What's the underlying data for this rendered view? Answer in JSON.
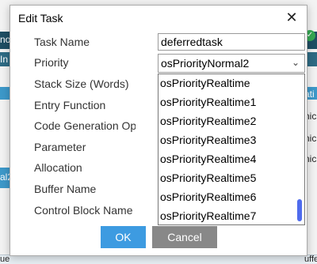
{
  "background": {
    "left_fragments": [
      "no",
      "In",
      "al2"
    ],
    "right_fragments": [
      "ati",
      "nic",
      "nic",
      "nic"
    ],
    "bottom_fragments": [
      "ueu",
      "uffe"
    ]
  },
  "dialog": {
    "title": "Edit Task",
    "fields": [
      {
        "label": "Task Name"
      },
      {
        "label": "Priority"
      },
      {
        "label": "Stack Size (Words)"
      },
      {
        "label": "Entry Function"
      },
      {
        "label": "Code Generation Option"
      },
      {
        "label": "Parameter"
      },
      {
        "label": "Allocation"
      },
      {
        "label": "Buffer Name"
      },
      {
        "label": "Control Block Name"
      }
    ],
    "task_name_value": "deferredtask",
    "priority_selected": "osPriorityNormal2",
    "priority_options": [
      "osPriorityRealtime",
      "osPriorityRealtime1",
      "osPriorityRealtime2",
      "osPriorityRealtime3",
      "osPriorityRealtime4",
      "osPriorityRealtime5",
      "osPriorityRealtime6",
      "osPriorityRealtime7"
    ],
    "ok_label": "OK",
    "cancel_label": "Cancel"
  },
  "icons": {
    "close": "close-icon",
    "chevron": "chevron-down-icon",
    "check": "check-circle-icon"
  },
  "colors": {
    "ok_button": "#3d9be1",
    "cancel_button": "#888888",
    "scroll_thumb": "#4f6bed"
  }
}
